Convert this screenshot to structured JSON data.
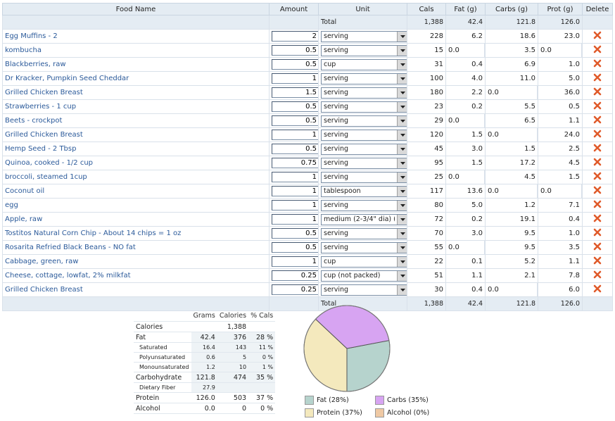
{
  "headers": {
    "food": "Food Name",
    "amount": "Amount",
    "unit": "Unit",
    "cals": "Cals",
    "fat": "Fat (g)",
    "carbs": "Carbs (g)",
    "prot": "Prot (g)",
    "delete": "Delete"
  },
  "totals": {
    "label": "Total",
    "cals": "1,388",
    "fat": "42.4",
    "carbs": "121.8",
    "prot": "126.0"
  },
  "rows": [
    {
      "name": "Egg Muffins - 2",
      "amount": "2",
      "unit": "serving",
      "cals": "228",
      "fat": "6.2",
      "carbs": "18.6",
      "prot": "23.0"
    },
    {
      "name": "kombucha",
      "amount": "0.5",
      "unit": "serving",
      "cals": "15",
      "fat": "0.0",
      "carbs": "3.5",
      "prot": "0.0"
    },
    {
      "name": "Blackberries, raw",
      "amount": "0.5",
      "unit": "cup",
      "cals": "31",
      "fat": "0.4",
      "carbs": "6.9",
      "prot": "1.0"
    },
    {
      "name": "Dr Kracker, Pumpkin Seed Cheddar",
      "amount": "1",
      "unit": "serving",
      "cals": "100",
      "fat": "4.0",
      "carbs": "11.0",
      "prot": "5.0"
    },
    {
      "name": "Grilled Chicken Breast",
      "amount": "1.5",
      "unit": "serving",
      "cals": "180",
      "fat": "2.2",
      "carbs": "0.0",
      "prot": "36.0"
    },
    {
      "name": "Strawberries - 1 cup",
      "amount": "0.5",
      "unit": "serving",
      "cals": "23",
      "fat": "0.2",
      "carbs": "5.5",
      "prot": "0.5"
    },
    {
      "name": "Beets - crockpot",
      "amount": "0.5",
      "unit": "serving",
      "cals": "29",
      "fat": "0.0",
      "carbs": "6.5",
      "prot": "1.1"
    },
    {
      "name": "Grilled Chicken Breast",
      "amount": "1",
      "unit": "serving",
      "cals": "120",
      "fat": "1.5",
      "carbs": "0.0",
      "prot": "24.0"
    },
    {
      "name": "Hemp Seed - 2 Tbsp",
      "amount": "0.5",
      "unit": "serving",
      "cals": "45",
      "fat": "3.0",
      "carbs": "1.5",
      "prot": "2.5"
    },
    {
      "name": "Quinoa, cooked - 1/2 cup",
      "amount": "0.75",
      "unit": "serving",
      "cals": "95",
      "fat": "1.5",
      "carbs": "17.2",
      "prot": "4.5"
    },
    {
      "name": "broccoli, steamed 1cup",
      "amount": "1",
      "unit": "serving",
      "cals": "25",
      "fat": "0.0",
      "carbs": "4.5",
      "prot": "1.5"
    },
    {
      "name": "Coconut oil",
      "amount": "1",
      "unit": "tablespoon",
      "cals": "117",
      "fat": "13.6",
      "carbs": "0.0",
      "prot": "0.0"
    },
    {
      "name": "egg",
      "amount": "1",
      "unit": "serving",
      "cals": "80",
      "fat": "5.0",
      "carbs": "1.2",
      "prot": "7.1"
    },
    {
      "name": "Apple, raw",
      "amount": "1",
      "unit": "medium (2-3/4\" dia) (",
      "cals": "72",
      "fat": "0.2",
      "carbs": "19.1",
      "prot": "0.4"
    },
    {
      "name": "Tostitos Natural Corn Chip - About 14 chips = 1 oz",
      "amount": "0.5",
      "unit": "serving",
      "cals": "70",
      "fat": "3.0",
      "carbs": "9.5",
      "prot": "1.0"
    },
    {
      "name": "Rosarita Refried Black Beans - NO fat",
      "amount": "0.5",
      "unit": "serving",
      "cals": "55",
      "fat": "0.0",
      "carbs": "9.5",
      "prot": "3.5"
    },
    {
      "name": "Cabbage, green, raw",
      "amount": "1",
      "unit": "cup",
      "cals": "22",
      "fat": "0.1",
      "carbs": "5.2",
      "prot": "1.1"
    },
    {
      "name": "Cheese, cottage, lowfat, 2% milkfat",
      "amount": "0.25",
      "unit": "cup (not packed)",
      "cals": "51",
      "fat": "1.1",
      "carbs": "2.1",
      "prot": "7.8"
    },
    {
      "name": "Grilled Chicken Breast",
      "amount": "0.25",
      "unit": "serving",
      "cals": "30",
      "fat": "0.4",
      "carbs": "0.0",
      "prot": "6.0"
    }
  ],
  "nutrition": {
    "headers": {
      "grams": "Grams",
      "calories": "Calories",
      "pct": "% Cals"
    },
    "rows": [
      {
        "label": "Calories",
        "grams": "",
        "cals": "1,388",
        "pct": "",
        "sub": false
      },
      {
        "label": "Fat",
        "grams": "42.4",
        "cals": "376",
        "pct": "28 %",
        "sub": false
      },
      {
        "label": "Saturated",
        "grams": "16.4",
        "cals": "143",
        "pct": "11 %",
        "sub": true
      },
      {
        "label": "Polyunsaturated",
        "grams": "0.6",
        "cals": "5",
        "pct": "0 %",
        "sub": true
      },
      {
        "label": "Monounsaturated",
        "grams": "1.2",
        "cals": "10",
        "pct": "1 %",
        "sub": true
      },
      {
        "label": "Carbohydrate",
        "grams": "121.8",
        "cals": "474",
        "pct": "35 %",
        "sub": false
      },
      {
        "label": "Dietary Fiber",
        "grams": "27.9",
        "cals": "",
        "pct": "",
        "sub": true
      },
      {
        "label": "Protein",
        "grams": "126.0",
        "cals": "503",
        "pct": "37 %",
        "sub": false
      },
      {
        "label": "Alcohol",
        "grams": "0.0",
        "cals": "0",
        "pct": "0 %",
        "sub": false
      }
    ]
  },
  "chart_data": {
    "type": "pie",
    "slices": [
      {
        "label": "Fat (28%)",
        "value": 28,
        "color": "#b6d3cd"
      },
      {
        "label": "Carbs (35%)",
        "value": 35,
        "color": "#d7a4f2"
      },
      {
        "label": "Protein (37%)",
        "value": 37,
        "color": "#f4e9bd"
      },
      {
        "label": "Alcohol (0%)",
        "value": 0,
        "color": "#efc9a4"
      }
    ]
  },
  "colors": {
    "link": "#2b5a9a",
    "header_bg": "#e4ecf3",
    "delete_icon": "#e05a2a"
  },
  "icons": {
    "delete": "x-icon",
    "dropdown": "chevron-down-icon"
  }
}
